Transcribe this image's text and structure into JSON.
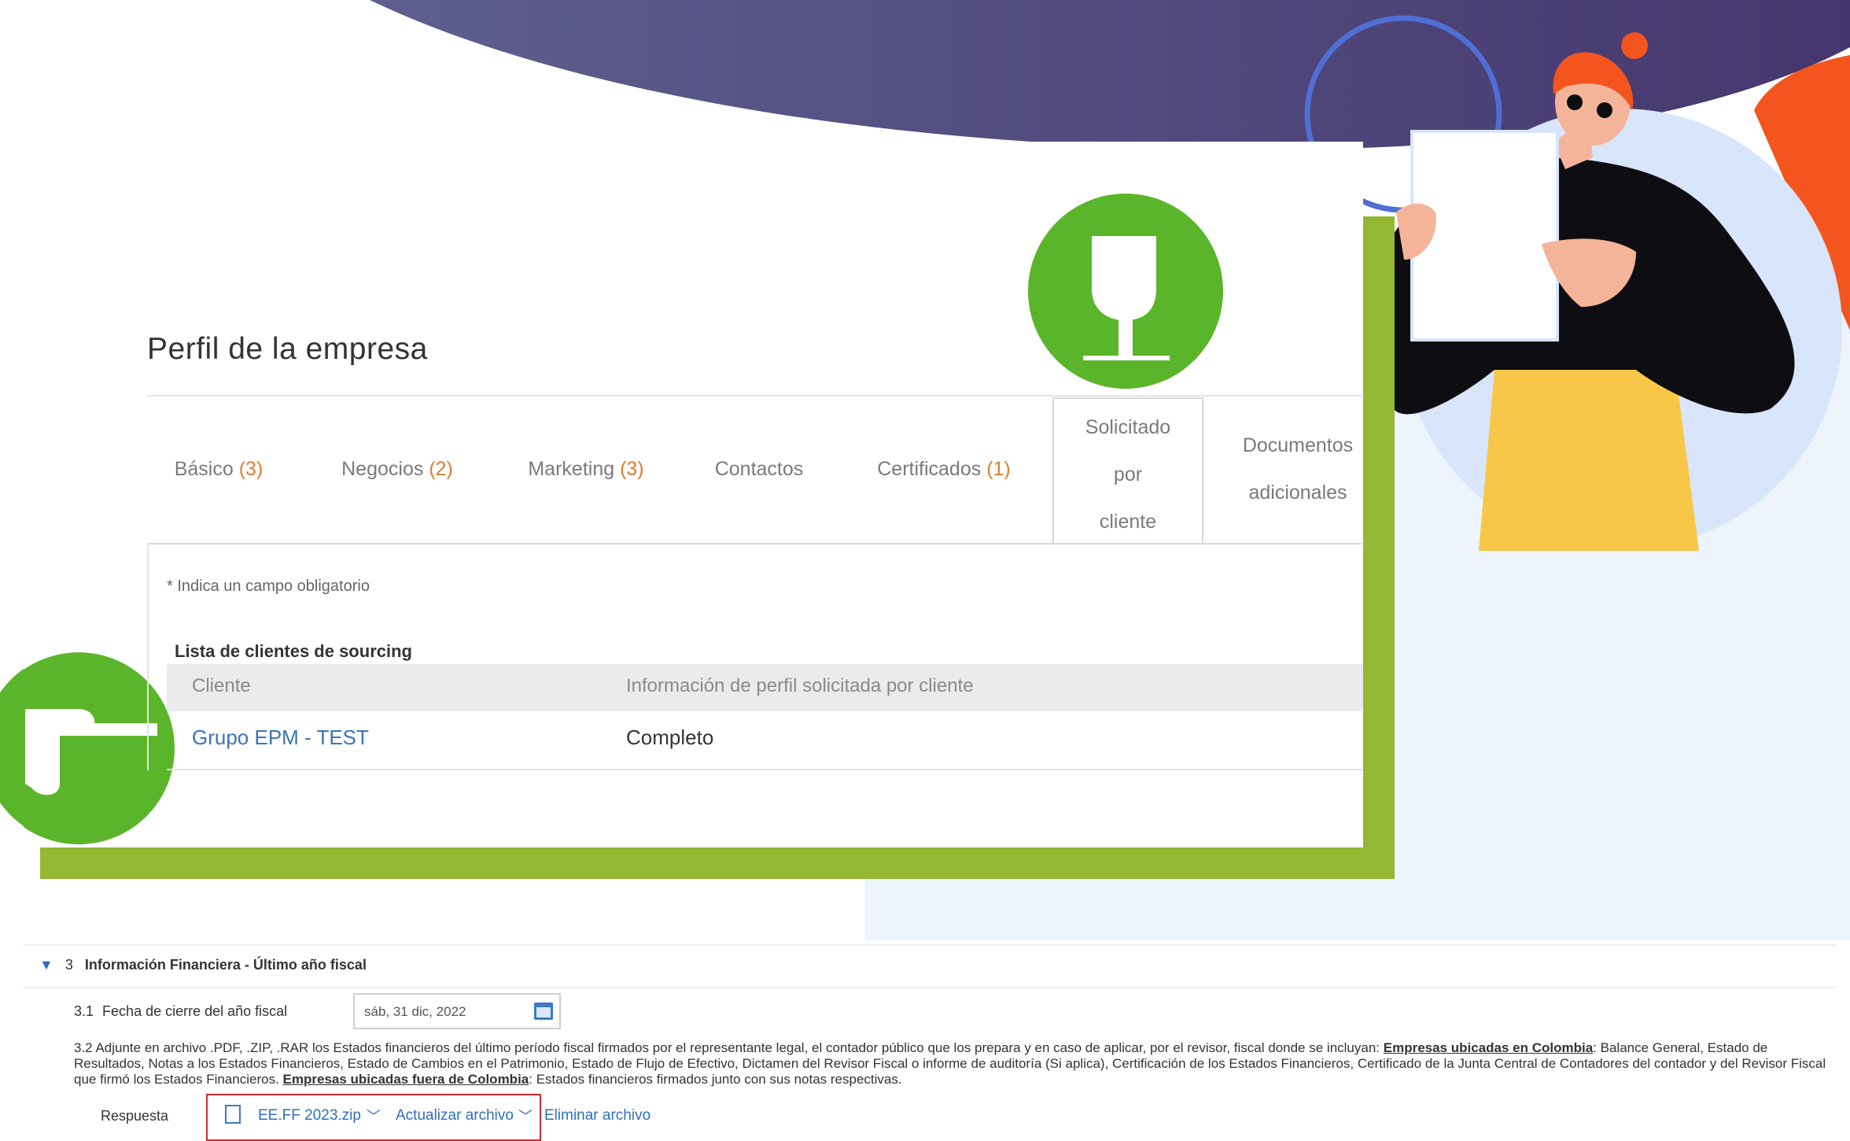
{
  "profile": {
    "title": "Perfil de la empresa",
    "tabs": [
      {
        "label": "Básico",
        "count": "(3)"
      },
      {
        "label": "Negocios",
        "count": "(2)"
      },
      {
        "label": "Marketing",
        "count": "(3)"
      },
      {
        "label": "Contactos",
        "count": ""
      },
      {
        "label": "Certificados",
        "count": "(1)"
      },
      {
        "label_lines": [
          "Solicitado",
          "por",
          "cliente"
        ],
        "active": true
      },
      {
        "label_lines": [
          "Documentos",
          "adicionales"
        ]
      }
    ],
    "required_note": "* Indica un campo obligatorio",
    "list_title": "Lista de clientes de sourcing",
    "table": {
      "headers": [
        "Cliente",
        "Información de perfil solicitada por cliente"
      ],
      "rows": [
        {
          "client": "Grupo EPM - TEST",
          "status": "Completo"
        }
      ]
    }
  },
  "form": {
    "section": {
      "number": "3",
      "title": "Información Financiera - Último año fiscal"
    },
    "q31": {
      "number": "3.1",
      "label": "Fecha de cierre del año fiscal",
      "value": "sáb, 31 dic, 2022"
    },
    "q32": {
      "number": "3.2",
      "text_a": "Adjunte en archivo .PDF, .ZIP, .RAR los Estados financieros del último período fiscal firmados por el representante legal, el contador público que los prepara y en caso de aplicar, por el revisor, fiscal donde se incluyan:",
      "bold_a": "Empresas ubicadas en Colombia",
      "text_b": ": Balance General, Estado de Resultados, Notas a los Estados Financieros, Estado de Cambios en el Patrimonio, Estado de Flujo de Efectivo, Dictamen del Revisor Fiscal o informe de auditoría (Si aplica), Certificación de los Estados Financieros, Certificado de la Junta Central de Contadores del contador y del Revisor Fiscal que firmó los Estados Financieros.",
      "bold_b": "Empresas ubicadas fuera de Colombia",
      "text_c": ": Estados financieros firmados junto con sus notas respectivas."
    },
    "response": {
      "label": "Respuesta",
      "file_name": "EE.FF 2023.zip",
      "update_label": "Actualizar archivo",
      "delete_label": "Eliminar archivo"
    }
  },
  "colors": {
    "header_purple": "#4b4a82",
    "accent_green": "#5bb52a",
    "frame_green": "#94b832",
    "accent_orange": "#f4541d",
    "link_blue": "#2f6fbf",
    "count_orange": "#e07b32"
  },
  "icons": [
    "pointing-down-hand-icon",
    "pointing-hand-icon",
    "calendar-icon",
    "file-zip-icon",
    "chevron-down-icon"
  ]
}
